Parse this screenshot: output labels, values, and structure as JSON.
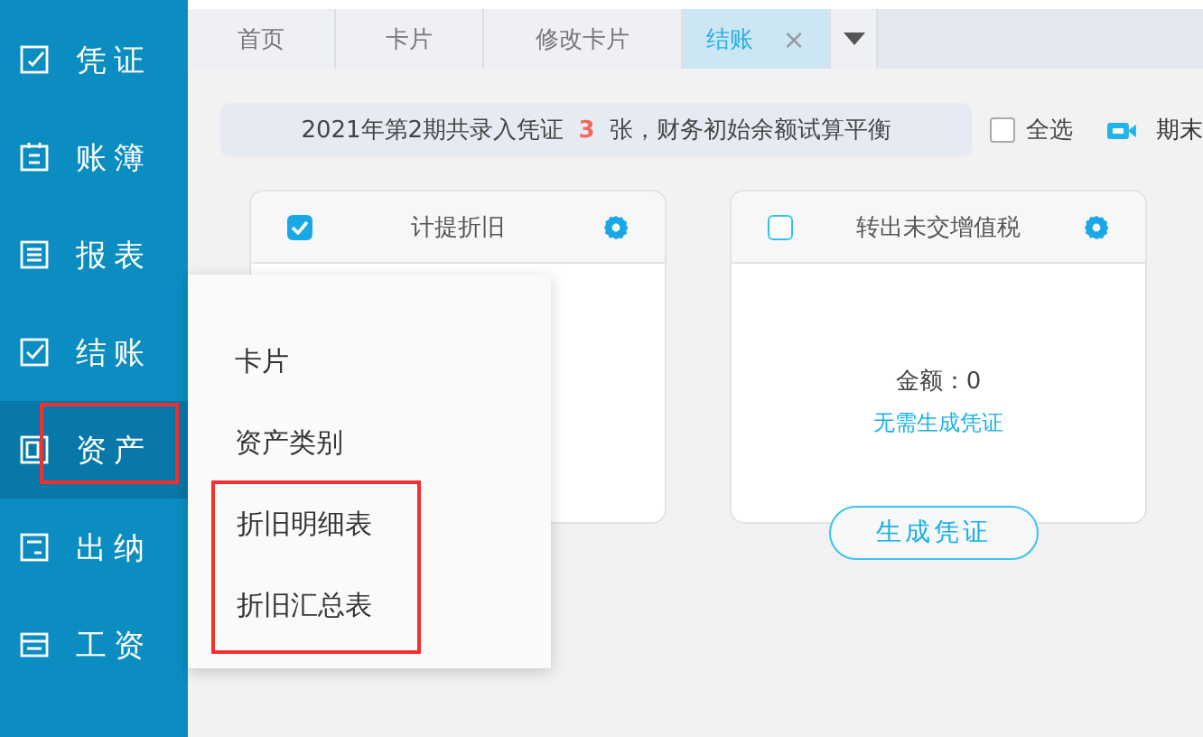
{
  "sidebar": {
    "items": [
      {
        "label": "凭证",
        "selected": false,
        "highlighted": false
      },
      {
        "label": "账簿",
        "selected": false,
        "highlighted": false
      },
      {
        "label": "报表",
        "selected": false,
        "highlighted": false
      },
      {
        "label": "结账",
        "selected": false,
        "highlighted": false
      },
      {
        "label": "资产",
        "selected": true,
        "highlighted": true
      },
      {
        "label": "出纳",
        "selected": false,
        "highlighted": false
      },
      {
        "label": "工资",
        "selected": false,
        "highlighted": false
      }
    ]
  },
  "tabs": [
    {
      "label": "首页",
      "selected": false
    },
    {
      "label": "卡片",
      "selected": false
    },
    {
      "label": "修改卡片",
      "selected": false
    },
    {
      "label": "结账",
      "selected": true,
      "close": "×"
    }
  ],
  "info_bar": {
    "text": "2021年第2期共录入凭证 **3** 张，财务初始余额试算平衡"
  },
  "select_all": {
    "label": "全选",
    "checked": false
  },
  "period_end": {
    "label": "期末"
  },
  "cards": [
    {
      "title": "计提折旧",
      "checked": true
    },
    {
      "title": "转出未交增值税",
      "checked": false,
      "amount": "金额：0",
      "note": "无需生成凭证",
      "button": "生成凭证"
    }
  ],
  "popup_menu": {
    "items": [
      {
        "label": "卡片",
        "highlighted": false
      },
      {
        "label": "资产类别",
        "highlighted": false
      },
      {
        "label": "折旧明细表",
        "highlighted": true
      },
      {
        "label": "折旧汇总表",
        "highlighted": true
      }
    ]
  }
}
